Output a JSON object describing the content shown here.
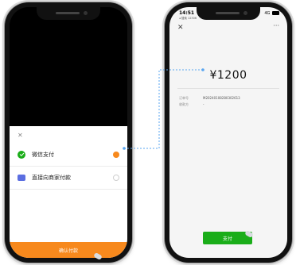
{
  "left_phone": {
    "sheet": {
      "close_icon": "close-icon",
      "options": [
        {
          "label": "微信支付",
          "icon": "wechat-pay-icon",
          "selected": true
        },
        {
          "label": "直接向商家付款",
          "icon": "card-icon",
          "selected": false
        }
      ],
      "confirm_label": "确认付款"
    }
  },
  "right_phone": {
    "status": {
      "time": "14:51",
      "sub": "◂ 搜索 12306",
      "signal": "4G"
    },
    "amount": "¥1200",
    "order_label": "订单号",
    "order_value": "M20240108280302613",
    "payee_label": "收款方",
    "payee_value": "-",
    "pay_label": "支付"
  },
  "colors": {
    "accent_orange": "#f7891d",
    "wechat_green": "#1aad19",
    "card_blue": "#5b6ee1",
    "connector_blue": "#5aa6f0"
  }
}
